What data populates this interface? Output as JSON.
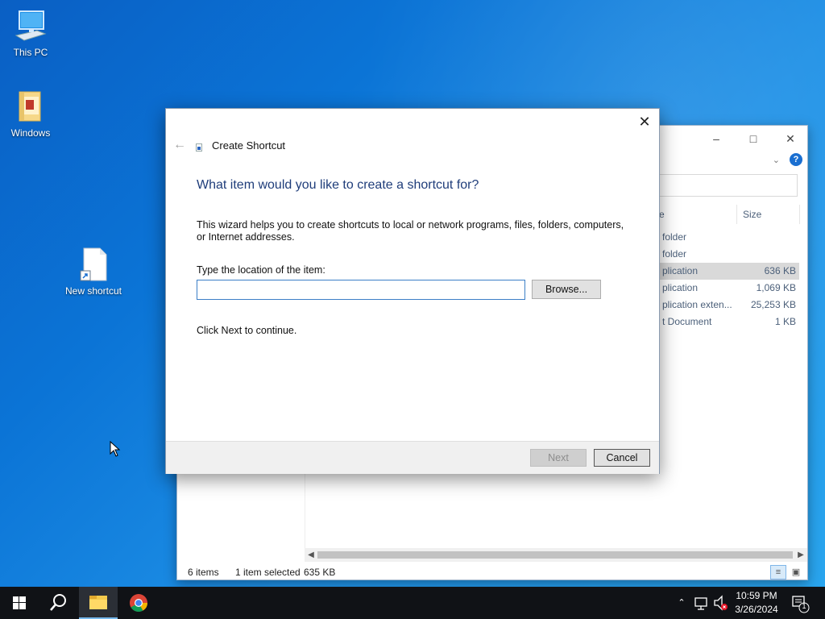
{
  "desktop": {
    "icons": [
      {
        "label": "This PC"
      },
      {
        "label": "Windows"
      },
      {
        "label": "New shortcut"
      }
    ]
  },
  "explorer": {
    "column_size": "Size",
    "column_name_partial": "e",
    "rows": [
      {
        "type": "folder",
        "size": ""
      },
      {
        "type": "folder",
        "size": ""
      },
      {
        "type": "plication",
        "size": "636 KB",
        "selected": true
      },
      {
        "type": "plication",
        "size": "1,069 KB"
      },
      {
        "type": "plication exten...",
        "size": "25,253 KB"
      },
      {
        "type": "t Document",
        "size": "1 KB"
      }
    ],
    "status": {
      "items": "6 items",
      "selected": "1 item selected",
      "size": "635 KB"
    }
  },
  "dialog": {
    "title": "Create Shortcut",
    "heading": "What item would you like to create a shortcut for?",
    "description": "This wizard helps you to create shortcuts to local or network programs, files, folders, computers, or Internet addresses.",
    "location_label": "Type the location of the item:",
    "location_value": "",
    "browse_label": "Browse...",
    "hint": "Click Next to continue.",
    "next_label": "Next",
    "cancel_label": "Cancel"
  },
  "taskbar": {
    "time": "10:59 PM",
    "date": "3/26/2024",
    "notification_count": "1"
  },
  "colors": {
    "heading": "#1f3d7a",
    "accent": "#1a6fd1",
    "taskbar": "#101216"
  }
}
